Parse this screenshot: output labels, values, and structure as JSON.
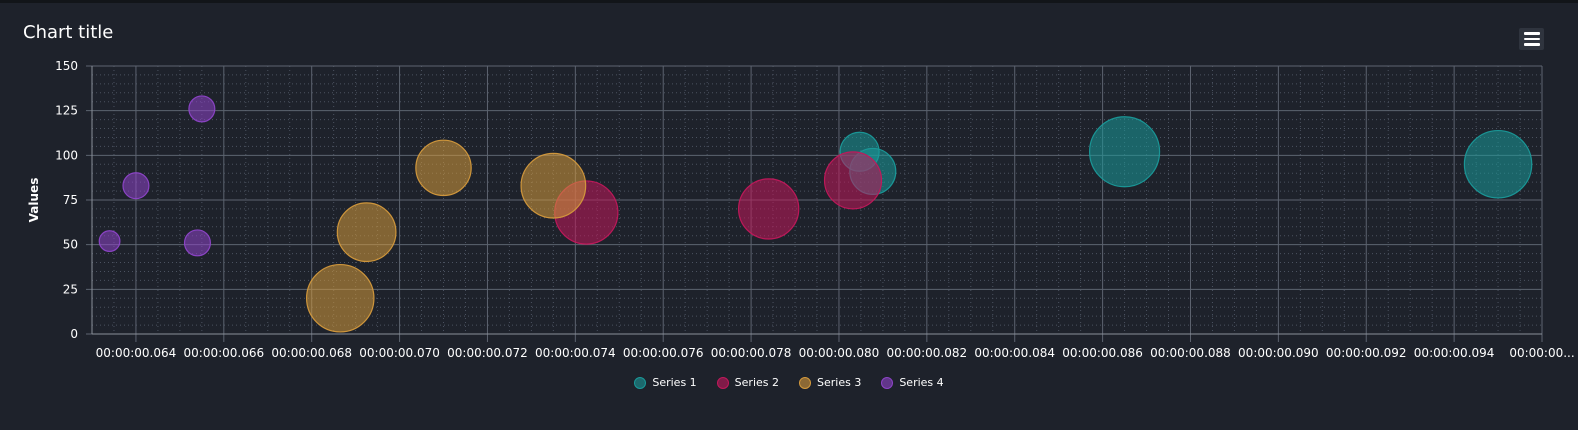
{
  "chart_data": {
    "type": "scatter",
    "variant": "bubble",
    "title": "Chart title",
    "xlabel": "",
    "ylabel": "Values",
    "ylim": [
      0,
      150
    ],
    "yticks": [
      0,
      25,
      50,
      75,
      100,
      125,
      150
    ],
    "xlim": [
      0.063,
      0.096
    ],
    "xticks": [
      {
        "value": 0.064,
        "label": "00:00:00.064"
      },
      {
        "value": 0.066,
        "label": "00:00:00.066"
      },
      {
        "value": 0.068,
        "label": "00:00:00.068"
      },
      {
        "value": 0.07,
        "label": "00:00:00.070"
      },
      {
        "value": 0.072,
        "label": "00:00:00.072"
      },
      {
        "value": 0.074,
        "label": "00:00:00.074"
      },
      {
        "value": 0.076,
        "label": "00:00:00.076"
      },
      {
        "value": 0.078,
        "label": "00:00:00.078"
      },
      {
        "value": 0.08,
        "label": "00:00:00.080"
      },
      {
        "value": 0.082,
        "label": "00:00:00.082"
      },
      {
        "value": 0.084,
        "label": "00:00:00.084"
      },
      {
        "value": 0.086,
        "label": "00:00:00.086"
      },
      {
        "value": 0.088,
        "label": "00:00:00.088"
      },
      {
        "value": 0.09,
        "label": "00:00:00.090"
      },
      {
        "value": 0.092,
        "label": "00:00:00.092"
      },
      {
        "value": 0.094,
        "label": "00:00:00.094"
      },
      {
        "value": 0.096,
        "label": "00:00:00..."
      }
    ],
    "grid": true,
    "legend_position": "bottom",
    "series": [
      {
        "name": "Series 1",
        "color": "#1a9a9a",
        "points": [
          {
            "x": 0.08047,
            "y": 102,
            "z": 6
          },
          {
            "x": 0.08077,
            "y": 91,
            "z": 9
          },
          {
            "x": 0.0865,
            "y": 102,
            "z": 24
          },
          {
            "x": 0.095,
            "y": 95,
            "z": 22
          }
        ]
      },
      {
        "name": "Series 2",
        "color": "#c2185b",
        "points": [
          {
            "x": 0.07425,
            "y": 68,
            "z": 19
          },
          {
            "x": 0.0784,
            "y": 70,
            "z": 17
          },
          {
            "x": 0.08032,
            "y": 86,
            "z": 15
          }
        ]
      },
      {
        "name": "Series 3",
        "color": "#d59a3c",
        "points": [
          {
            "x": 0.06865,
            "y": 20,
            "z": 22
          },
          {
            "x": 0.06925,
            "y": 57,
            "z": 16
          },
          {
            "x": 0.071,
            "y": 93,
            "z": 14
          },
          {
            "x": 0.0735,
            "y": 83,
            "z": 20
          }
        ]
      },
      {
        "name": "Series 4",
        "color": "#8e44c9",
        "points": [
          {
            "x": 0.0634,
            "y": 52,
            "z": 1
          },
          {
            "x": 0.064,
            "y": 83,
            "z": 2
          },
          {
            "x": 0.0654,
            "y": 51,
            "z": 2
          },
          {
            "x": 0.0655,
            "y": 126,
            "z": 2
          }
        ]
      }
    ]
  },
  "toolbar": {
    "menu_icon": "hamburger-menu-icon"
  }
}
